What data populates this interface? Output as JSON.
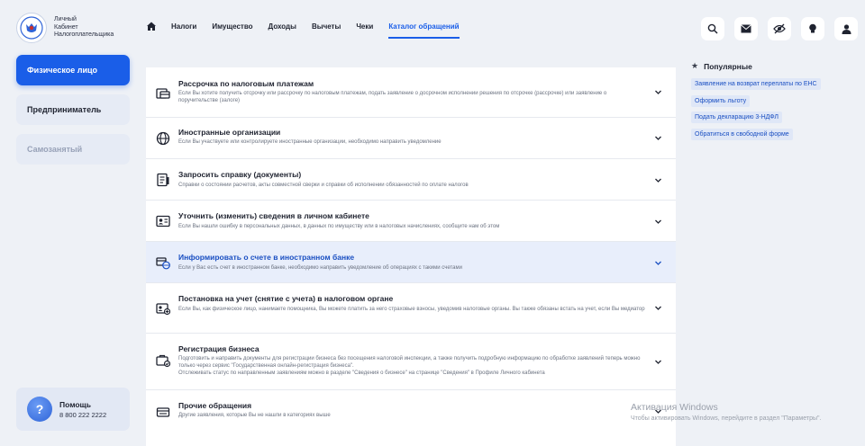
{
  "logo": {
    "line1": "Личный",
    "line2": "Кабинет",
    "line3": "Налогоплательщика"
  },
  "sidebar": {
    "items": [
      {
        "label": "Физическое лицо",
        "state": "active"
      },
      {
        "label": "Предприниматель",
        "state": "normal"
      },
      {
        "label": "Самозанятый",
        "state": "disabled"
      }
    ],
    "help": {
      "title": "Помощь",
      "phone": "8 800 222 2222"
    }
  },
  "nav": {
    "items": [
      {
        "label": "Налоги"
      },
      {
        "label": "Имущество"
      },
      {
        "label": "Доходы"
      },
      {
        "label": "Вычеты"
      },
      {
        "label": "Чеки"
      },
      {
        "label": "Каталог обращений",
        "active": true
      }
    ]
  },
  "header_icons": [
    "search-icon",
    "mail-icon",
    "eye-off-icon",
    "lightbulb-icon",
    "user-icon"
  ],
  "list": {
    "rows": [
      {
        "icon": "payment-icon",
        "title": "Рассрочка по налоговым платежам",
        "desc": "Если Вы хотите получить отсрочку или рассрочку по налоговым платежам, подать заявление о досрочном исполнении решения по отсрочке (рассрочке) или заявление о поручительстве (залоге)"
      },
      {
        "icon": "globe-icon",
        "title": "Иностранные организации",
        "desc": "Если Вы участвуете или контролируете иностранные организации, необходимо направить уведомление"
      },
      {
        "icon": "document-icon",
        "title": "Запросить справку (документы)",
        "desc": "Справки о состоянии расчетов, акты совместной сверки и справки об исполнении обязанностей по оплате налогов"
      },
      {
        "icon": "id-card-icon",
        "title": "Уточнить (изменить) сведения в личном кабинете",
        "desc": "Если Вы нашли ошибку в персональных данных, в данных по имуществу или в налоговых начислениях, сообщите нам об этом"
      },
      {
        "icon": "foreign-bank-icon",
        "title": "Информировать о счете в иностранном банке",
        "desc": "Если у Вас есть счет в иностранном банке, необходимо направить уведомление об операциях с такими счетами",
        "highlight": true
      },
      {
        "icon": "registration-icon",
        "title": "Постановка на учет (снятие с учета) в налоговом органе",
        "desc": "Если Вы, как физическое лицо, нанимаете помощника, Вы можете платить за него страховые взносы, уведомив налоговые органы. Вы также обязаны встать на учет, если Вы медиатор"
      },
      {
        "icon": "business-icon",
        "title": "Регистрация бизнеса",
        "desc": "Подготовить и направить документы для регистрации бизнеса без посещения налоговой инспекции, а также получить подробную информацию по обработке заявлений теперь можно только через сервис \"Государственная онлайн-регистрация бизнеса\".\nОтслеживать статус по направленным заявлениям можно в разделе \"Сведения о бизнесе\" на странице \"Сведения\" в Профиле Личного кабинета"
      },
      {
        "icon": "other-requests-icon",
        "title": "Прочие обращения",
        "desc": "Другие заявления, которые Вы не нашли в категориях выше"
      }
    ]
  },
  "popular": {
    "title": "Популярные",
    "links": [
      {
        "label": "Заявление на возврат переплаты по ЕНС"
      },
      {
        "label": "Оформить льготу"
      },
      {
        "label": "Подать декларацию 3-НДФЛ"
      },
      {
        "label": "Обратиться в свободной форме"
      }
    ]
  },
  "watermark": {
    "title": "Активация Windows",
    "subtitle": "Чтобы активировать Windows, перейдите в раздел \"Параметры\"."
  },
  "colors": {
    "accent": "#1a5ee8",
    "background": "#eef1f6",
    "highlight_row": "#e8eefb",
    "chip_bg": "#dfe7f7"
  }
}
